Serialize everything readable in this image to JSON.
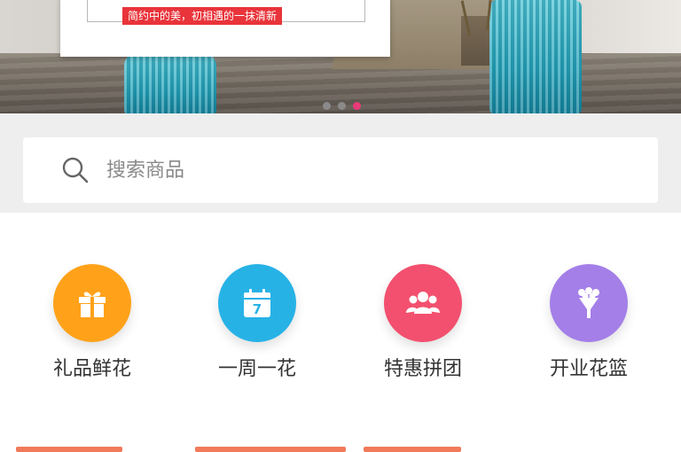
{
  "banner": {
    "slogan": "简约中的美，初相遇的一抹清新",
    "slide_count": 3,
    "active_slide": 3,
    "colors": {
      "tag": "#e8343a",
      "dot_active": "#e83a78",
      "dot_inactive": "#8a8a8a"
    }
  },
  "search": {
    "placeholder": "搜索商品",
    "icon": "search-icon"
  },
  "categories": [
    {
      "label": "礼品鲜花",
      "icon": "gift-icon",
      "color": "#ffa21a"
    },
    {
      "label": "一周一花",
      "icon": "calendar-icon",
      "color": "#27b2e6",
      "calendar_day": "7"
    },
    {
      "label": "特惠拼团",
      "icon": "group-icon",
      "color": "#f2506e"
    },
    {
      "label": "开业花篮",
      "icon": "bouquet-icon",
      "color": "#a47fe8"
    }
  ]
}
